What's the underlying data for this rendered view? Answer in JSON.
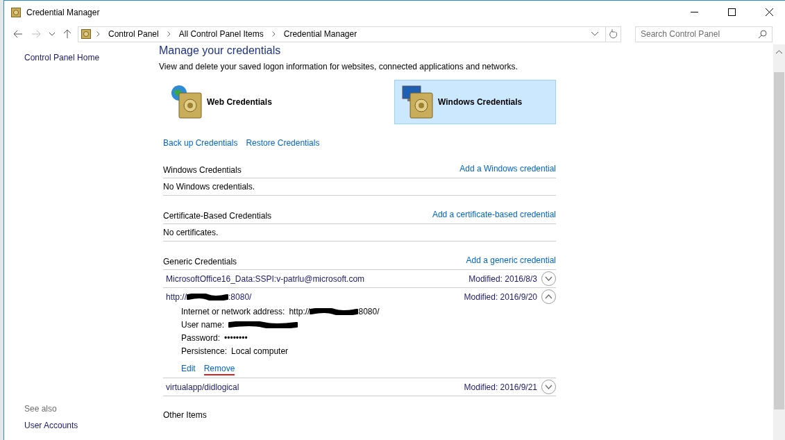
{
  "window": {
    "title": "Credential Manager"
  },
  "address_bar": {
    "breadcrumbs": [
      "Control Panel",
      "All Control Panel Items",
      "Credential Manager"
    ]
  },
  "search": {
    "placeholder": "Search Control Panel"
  },
  "sidebar": {
    "home_link": "Control Panel Home",
    "see_also_title": "See also",
    "see_also_links": [
      "User Accounts"
    ]
  },
  "heading": "Manage your credentials",
  "description": "View and delete your saved logon information for websites, connected applications and networks.",
  "credential_types": [
    {
      "label": "Web Credentials",
      "kind": "web",
      "selected": false
    },
    {
      "label": "Windows Credentials",
      "kind": "windows",
      "selected": true
    }
  ],
  "actions": [
    "Back up Credentials",
    "Restore Credentials"
  ],
  "sections": [
    {
      "title": "Windows Credentials",
      "add_link": "Add a Windows credential",
      "empty_text": "No Windows credentials."
    },
    {
      "title": "Certificate-Based Credentials",
      "add_link": "Add a certificate-based credential",
      "empty_text": "No certificates."
    },
    {
      "title": "Generic Credentials",
      "add_link": "Add a generic credential",
      "items": [
        {
          "name_start": "MicrosoftOffice16_Data:SSPI:v-patrlu@microsoft.com",
          "modified_label": "Modified:",
          "modified": "2016/8/3",
          "expanded": false
        },
        {
          "name_start": "http://",
          "redacted": true,
          "name_end": ":8080/",
          "modified_label": "Modified:",
          "modified": "2016/9/20",
          "expanded": true,
          "details": [
            {
              "label": "Internet or network address:",
              "value_start": "http://",
              "redacted": true,
              "value_end": "8080/"
            },
            {
              "label": "User name:",
              "redacted": true
            },
            {
              "label": "Password:",
              "value_start": "••••••••"
            },
            {
              "label": "Persistence:",
              "value_start": "Local computer"
            }
          ],
          "links": [
            {
              "label": "Edit",
              "underlined": false
            },
            {
              "label": "Remove",
              "underlined": true
            }
          ]
        },
        {
          "name_start": "virtualapp/didlogical",
          "modified_label": "Modified:",
          "modified": "2016/9/21",
          "expanded": false
        }
      ]
    },
    {
      "title": "Other Items"
    }
  ]
}
